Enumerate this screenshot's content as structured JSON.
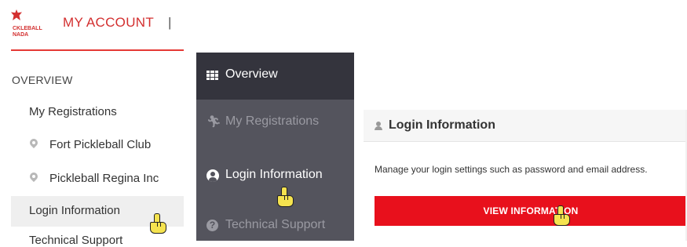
{
  "header": {
    "logo_line1": "CKLEBALL",
    "logo_line2": "NADA",
    "my_account": "MY ACCOUNT",
    "separator": "|"
  },
  "left_nav": {
    "heading": "OVERVIEW",
    "items": [
      {
        "label": "My Registrations"
      },
      {
        "label": "Fort Pickleball Club",
        "icon": "map-pin-icon"
      },
      {
        "label": "Pickleball Regina Inc",
        "icon": "map-pin-icon"
      },
      {
        "label": "Login Information",
        "active": true
      },
      {
        "label": "Technical Support"
      }
    ]
  },
  "sidebar": {
    "items": [
      {
        "label": "Overview",
        "icon": "grid-icon"
      },
      {
        "label": "My Registrations",
        "icon": "registration-icon"
      },
      {
        "label": "Login Information",
        "icon": "user-circle-icon"
      },
      {
        "label": "Technical Support",
        "icon": "question-circle-icon"
      }
    ]
  },
  "card": {
    "title": "Login Information",
    "description": "Manage your login settings such as password and email address.",
    "button_label": "VIEW INFORMATION"
  },
  "colors": {
    "brand_red": "#e8101c",
    "sidebar_bg": "#54545d",
    "sidebar_active_bg": "#34343d"
  }
}
